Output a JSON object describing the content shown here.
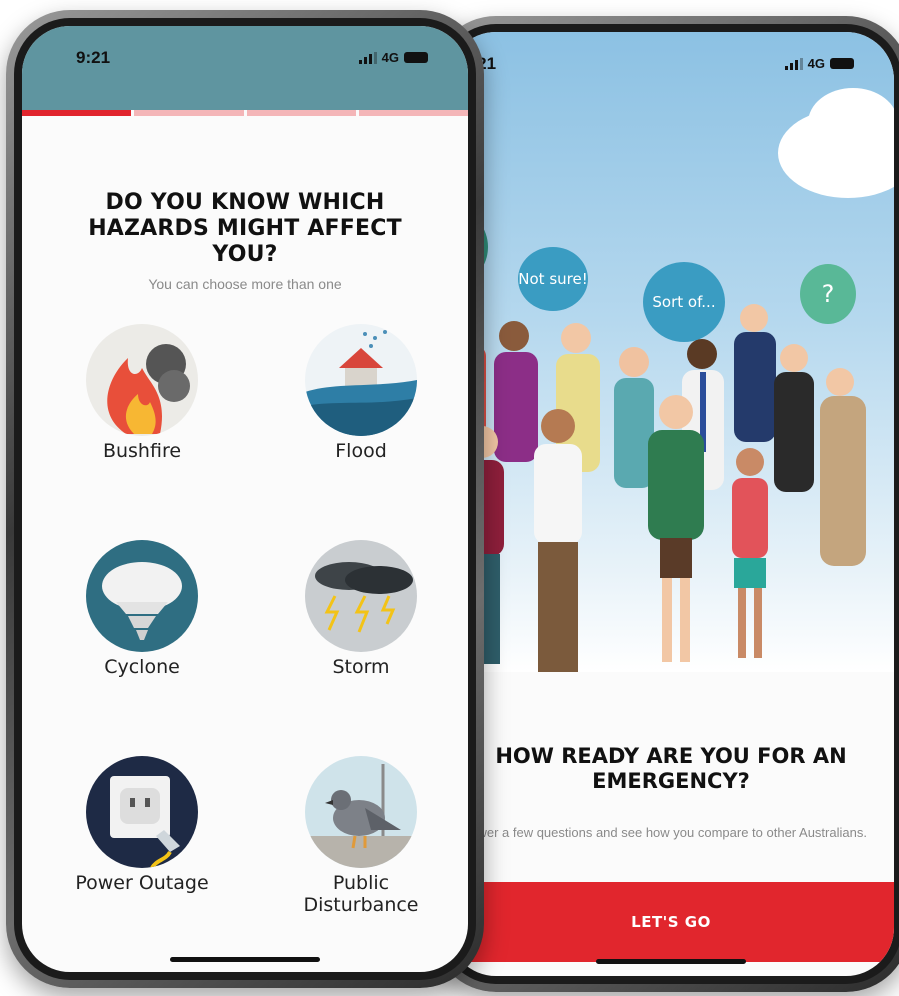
{
  "left_screen": {
    "status_bar": {
      "time": "9:21",
      "network": "4G"
    },
    "progress": {
      "steps": 4,
      "current": 1
    },
    "title": "DO YOU KNOW WHICH HAZARDS MIGHT AFFECT YOU?",
    "subtitle": "You can choose more than one",
    "hazards": [
      {
        "label": "Bushfire",
        "icon": "bushfire-icon"
      },
      {
        "label": "Flood",
        "icon": "flood-icon"
      },
      {
        "label": "Cyclone",
        "icon": "cyclone-icon"
      },
      {
        "label": "Storm",
        "icon": "storm-icon"
      },
      {
        "label": "Power Outage",
        "icon": "power-outage-icon"
      },
      {
        "label": "Public Disturbance",
        "icon": "public-disturbance-icon"
      }
    ]
  },
  "right_screen": {
    "status_bar": {
      "time": "9:21",
      "network": "4G"
    },
    "bubbles": [
      "Not sure!",
      "Sort of...",
      "?"
    ],
    "title": "HOW READY ARE YOU FOR AN EMERGENCY?",
    "subtitle": "Answer a few questions and see how you compare to other Australians.",
    "cta_label": "LET'S GO"
  },
  "colors": {
    "accent_red": "#e1252d",
    "header_teal": "#5f95a0",
    "progress_inactive": "#f4b6b8"
  }
}
